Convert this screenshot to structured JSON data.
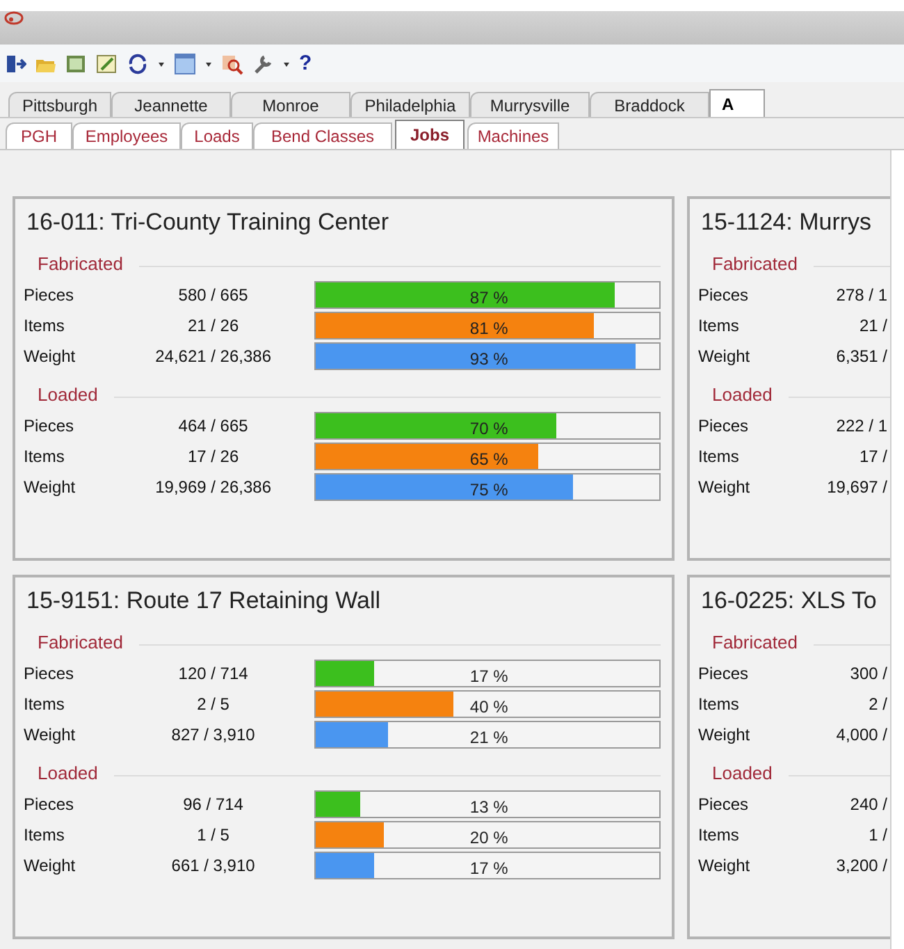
{
  "toolbar": {
    "help_label": "?"
  },
  "location_tabs": [
    {
      "label": "Pittsburgh",
      "selected": false
    },
    {
      "label": "Jeannette",
      "selected": false
    },
    {
      "label": "Monroe",
      "selected": false
    },
    {
      "label": "Philadelphia",
      "selected": false
    },
    {
      "label": "Murrysville",
      "selected": false
    },
    {
      "label": "Braddock",
      "selected": false
    },
    {
      "label": "A",
      "selected": true
    }
  ],
  "view_tabs": [
    {
      "label": "PGH",
      "selected": false
    },
    {
      "label": "Employees",
      "selected": false
    },
    {
      "label": "Loads",
      "selected": false
    },
    {
      "label": "Bend Classes",
      "selected": false
    },
    {
      "label": "Jobs",
      "selected": true
    },
    {
      "label": "Machines",
      "selected": false
    }
  ],
  "job_cards": [
    {
      "title": "16-011: Tri-County Training Center",
      "sections": [
        {
          "label": "Fabricated",
          "rows": [
            {
              "label": "Pieces",
              "value": "580 / 665",
              "level": 0.87,
              "reading": "87 %",
              "color": "#3cbf1e"
            },
            {
              "label": "Items",
              "value": "21 / 26",
              "level": 0.81,
              "reading": "81 %",
              "color": "#f5820f"
            },
            {
              "label": "Weight",
              "value": "24,621 / 26,386",
              "level": 0.93,
              "reading": "93 %",
              "color": "#4a96f0"
            }
          ]
        },
        {
          "label": "Loaded",
          "rows": [
            {
              "label": "Pieces",
              "value": "464 / 665",
              "level": 0.7,
              "reading": "70 %",
              "color": "#3cbf1e"
            },
            {
              "label": "Items",
              "value": "17 / 26",
              "level": 0.65,
              "reading": "65 %",
              "color": "#f5820f"
            },
            {
              "label": "Weight",
              "value": "19,969 / 26,386",
              "level": 0.75,
              "reading": "75 %",
              "color": "#4a96f0"
            }
          ]
        }
      ]
    },
    {
      "title": "15-1124: Murrys",
      "sections": [
        {
          "label": "Fabricated",
          "rows": [
            {
              "label": "Pieces",
              "value": "278 / 1"
            },
            {
              "label": "Items",
              "value": "21 /"
            },
            {
              "label": "Weight",
              "value": "6,351 /"
            }
          ]
        },
        {
          "label": "Loaded",
          "rows": [
            {
              "label": "Pieces",
              "value": "222 / 1"
            },
            {
              "label": "Items",
              "value": "17 /"
            },
            {
              "label": "Weight",
              "value": "19,697 /"
            }
          ]
        }
      ]
    },
    {
      "title": "15-9151: Route 17 Retaining Wall",
      "sections": [
        {
          "label": "Fabricated",
          "rows": [
            {
              "label": "Pieces",
              "value": "120 / 714",
              "level": 0.17,
              "reading": "17 %",
              "color": "#3cbf1e"
            },
            {
              "label": "Items",
              "value": "2 / 5",
              "level": 0.4,
              "reading": "40 %",
              "color": "#f5820f"
            },
            {
              "label": "Weight",
              "value": "827 / 3,910",
              "level": 0.21,
              "reading": "21 %",
              "color": "#4a96f0"
            }
          ]
        },
        {
          "label": "Loaded",
          "rows": [
            {
              "label": "Pieces",
              "value": "96 / 714",
              "level": 0.13,
              "reading": "13 %",
              "color": "#3cbf1e"
            },
            {
              "label": "Items",
              "value": "1 / 5",
              "level": 0.2,
              "reading": "20 %",
              "color": "#f5820f"
            },
            {
              "label": "Weight",
              "value": "661 / 3,910",
              "level": 0.17,
              "reading": "17 %",
              "color": "#4a96f0"
            }
          ]
        }
      ]
    },
    {
      "title": "16-0225: XLS To",
      "sections": [
        {
          "label": "Fabricated",
          "rows": [
            {
              "label": "Pieces",
              "value": "300 /"
            },
            {
              "label": "Items",
              "value": "2 /"
            },
            {
              "label": "Weight",
              "value": "4,000 /"
            }
          ]
        },
        {
          "label": "Loaded",
          "rows": [
            {
              "label": "Pieces",
              "value": "240 /"
            },
            {
              "label": "Items",
              "value": "1 /"
            },
            {
              "label": "Weight",
              "value": "3,200 /"
            }
          ]
        }
      ]
    }
  ]
}
